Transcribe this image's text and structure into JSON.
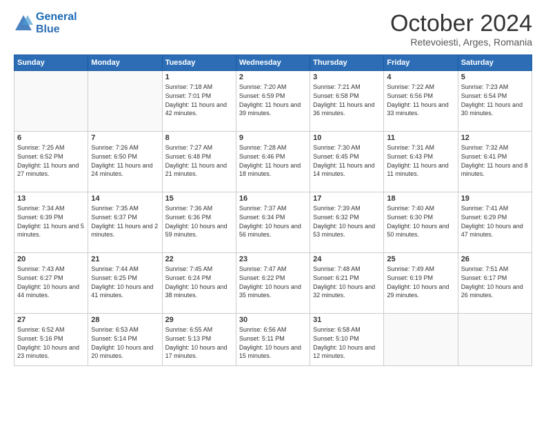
{
  "header": {
    "logo_line1": "General",
    "logo_line2": "Blue",
    "title": "October 2024",
    "subtitle": "Retevoiesti, Arges, Romania"
  },
  "columns": [
    "Sunday",
    "Monday",
    "Tuesday",
    "Wednesday",
    "Thursday",
    "Friday",
    "Saturday"
  ],
  "weeks": [
    [
      {
        "day": "",
        "info": ""
      },
      {
        "day": "",
        "info": ""
      },
      {
        "day": "1",
        "info": "Sunrise: 7:18 AM\nSunset: 7:01 PM\nDaylight: 11 hours and 42 minutes."
      },
      {
        "day": "2",
        "info": "Sunrise: 7:20 AM\nSunset: 6:59 PM\nDaylight: 11 hours and 39 minutes."
      },
      {
        "day": "3",
        "info": "Sunrise: 7:21 AM\nSunset: 6:58 PM\nDaylight: 11 hours and 36 minutes."
      },
      {
        "day": "4",
        "info": "Sunrise: 7:22 AM\nSunset: 6:56 PM\nDaylight: 11 hours and 33 minutes."
      },
      {
        "day": "5",
        "info": "Sunrise: 7:23 AM\nSunset: 6:54 PM\nDaylight: 11 hours and 30 minutes."
      }
    ],
    [
      {
        "day": "6",
        "info": "Sunrise: 7:25 AM\nSunset: 6:52 PM\nDaylight: 11 hours and 27 minutes."
      },
      {
        "day": "7",
        "info": "Sunrise: 7:26 AM\nSunset: 6:50 PM\nDaylight: 11 hours and 24 minutes."
      },
      {
        "day": "8",
        "info": "Sunrise: 7:27 AM\nSunset: 6:48 PM\nDaylight: 11 hours and 21 minutes."
      },
      {
        "day": "9",
        "info": "Sunrise: 7:28 AM\nSunset: 6:46 PM\nDaylight: 11 hours and 18 minutes."
      },
      {
        "day": "10",
        "info": "Sunrise: 7:30 AM\nSunset: 6:45 PM\nDaylight: 11 hours and 14 minutes."
      },
      {
        "day": "11",
        "info": "Sunrise: 7:31 AM\nSunset: 6:43 PM\nDaylight: 11 hours and 11 minutes."
      },
      {
        "day": "12",
        "info": "Sunrise: 7:32 AM\nSunset: 6:41 PM\nDaylight: 11 hours and 8 minutes."
      }
    ],
    [
      {
        "day": "13",
        "info": "Sunrise: 7:34 AM\nSunset: 6:39 PM\nDaylight: 11 hours and 5 minutes."
      },
      {
        "day": "14",
        "info": "Sunrise: 7:35 AM\nSunset: 6:37 PM\nDaylight: 11 hours and 2 minutes."
      },
      {
        "day": "15",
        "info": "Sunrise: 7:36 AM\nSunset: 6:36 PM\nDaylight: 10 hours and 59 minutes."
      },
      {
        "day": "16",
        "info": "Sunrise: 7:37 AM\nSunset: 6:34 PM\nDaylight: 10 hours and 56 minutes."
      },
      {
        "day": "17",
        "info": "Sunrise: 7:39 AM\nSunset: 6:32 PM\nDaylight: 10 hours and 53 minutes."
      },
      {
        "day": "18",
        "info": "Sunrise: 7:40 AM\nSunset: 6:30 PM\nDaylight: 10 hours and 50 minutes."
      },
      {
        "day": "19",
        "info": "Sunrise: 7:41 AM\nSunset: 6:29 PM\nDaylight: 10 hours and 47 minutes."
      }
    ],
    [
      {
        "day": "20",
        "info": "Sunrise: 7:43 AM\nSunset: 6:27 PM\nDaylight: 10 hours and 44 minutes."
      },
      {
        "day": "21",
        "info": "Sunrise: 7:44 AM\nSunset: 6:25 PM\nDaylight: 10 hours and 41 minutes."
      },
      {
        "day": "22",
        "info": "Sunrise: 7:45 AM\nSunset: 6:24 PM\nDaylight: 10 hours and 38 minutes."
      },
      {
        "day": "23",
        "info": "Sunrise: 7:47 AM\nSunset: 6:22 PM\nDaylight: 10 hours and 35 minutes."
      },
      {
        "day": "24",
        "info": "Sunrise: 7:48 AM\nSunset: 6:21 PM\nDaylight: 10 hours and 32 minutes."
      },
      {
        "day": "25",
        "info": "Sunrise: 7:49 AM\nSunset: 6:19 PM\nDaylight: 10 hours and 29 minutes."
      },
      {
        "day": "26",
        "info": "Sunrise: 7:51 AM\nSunset: 6:17 PM\nDaylight: 10 hours and 26 minutes."
      }
    ],
    [
      {
        "day": "27",
        "info": "Sunrise: 6:52 AM\nSunset: 5:16 PM\nDaylight: 10 hours and 23 minutes."
      },
      {
        "day": "28",
        "info": "Sunrise: 6:53 AM\nSunset: 5:14 PM\nDaylight: 10 hours and 20 minutes."
      },
      {
        "day": "29",
        "info": "Sunrise: 6:55 AM\nSunset: 5:13 PM\nDaylight: 10 hours and 17 minutes."
      },
      {
        "day": "30",
        "info": "Sunrise: 6:56 AM\nSunset: 5:11 PM\nDaylight: 10 hours and 15 minutes."
      },
      {
        "day": "31",
        "info": "Sunrise: 6:58 AM\nSunset: 5:10 PM\nDaylight: 10 hours and 12 minutes."
      },
      {
        "day": "",
        "info": ""
      },
      {
        "day": "",
        "info": ""
      }
    ]
  ]
}
